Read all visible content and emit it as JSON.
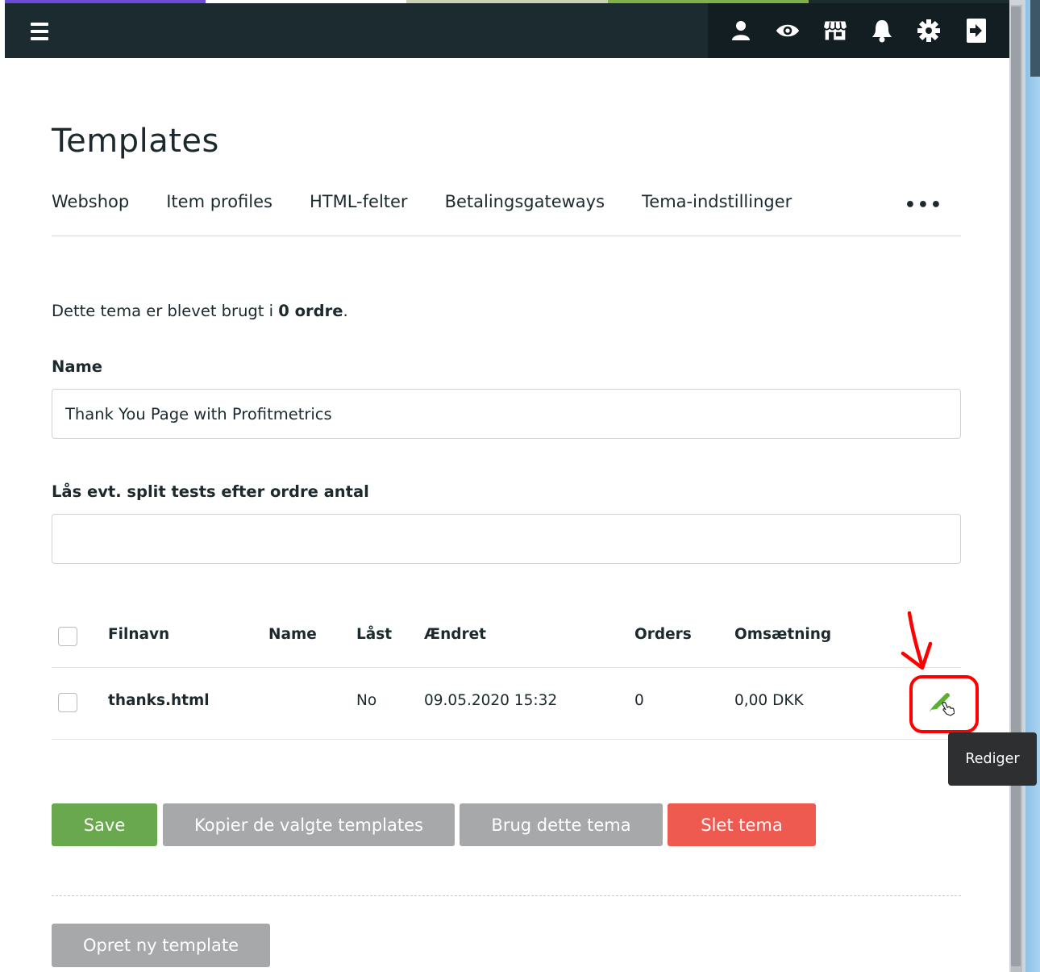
{
  "colors": {
    "topbar": "#1c2b30",
    "accent_purple": "#6c4bd6",
    "save_green": "#6aa84f",
    "neutral_grey": "#a6a8aa",
    "danger_red": "#ee5a4f",
    "edit_pen_green": "#5cb030",
    "annotation_red": "#ff0000"
  },
  "topbar": {
    "menu_icon": "hamburger-icon",
    "icons": [
      "user-icon",
      "eye-icon",
      "store-icon",
      "bell-icon",
      "gear-icon",
      "logout-icon"
    ]
  },
  "page": {
    "title": "Templates",
    "tabs": [
      {
        "label": "Webshop"
      },
      {
        "label": "Item profiles"
      },
      {
        "label": "HTML-felter"
      },
      {
        "label": "Betalingsgateways"
      },
      {
        "label": "Tema-indstillinger"
      }
    ],
    "more_label": "•••",
    "usage_prefix": "Dette tema er blevet brugt i ",
    "usage_count": "0 ordre",
    "usage_suffix": "."
  },
  "form": {
    "name_label": "Name",
    "name_value": "Thank You Page with Profitmetrics",
    "lock_label": "Lås evt. split tests efter ordre antal",
    "lock_value": ""
  },
  "table": {
    "columns": [
      "Filnavn",
      "Name",
      "Låst",
      "Ændret",
      "Orders",
      "Omsætning"
    ],
    "rows": [
      {
        "filnavn": "thanks.html",
        "name": "",
        "laast": "No",
        "aendret": "09.05.2020 15:32",
        "orders": "0",
        "omsaetning": "0,00 DKK"
      }
    ],
    "edit_icon": "pencil-icon",
    "tooltip": "Rediger"
  },
  "actions": {
    "save": "Save",
    "copy": "Kopier de valgte templates",
    "use": "Brug dette tema",
    "delete": "Slet tema",
    "create": "Opret ny template"
  }
}
